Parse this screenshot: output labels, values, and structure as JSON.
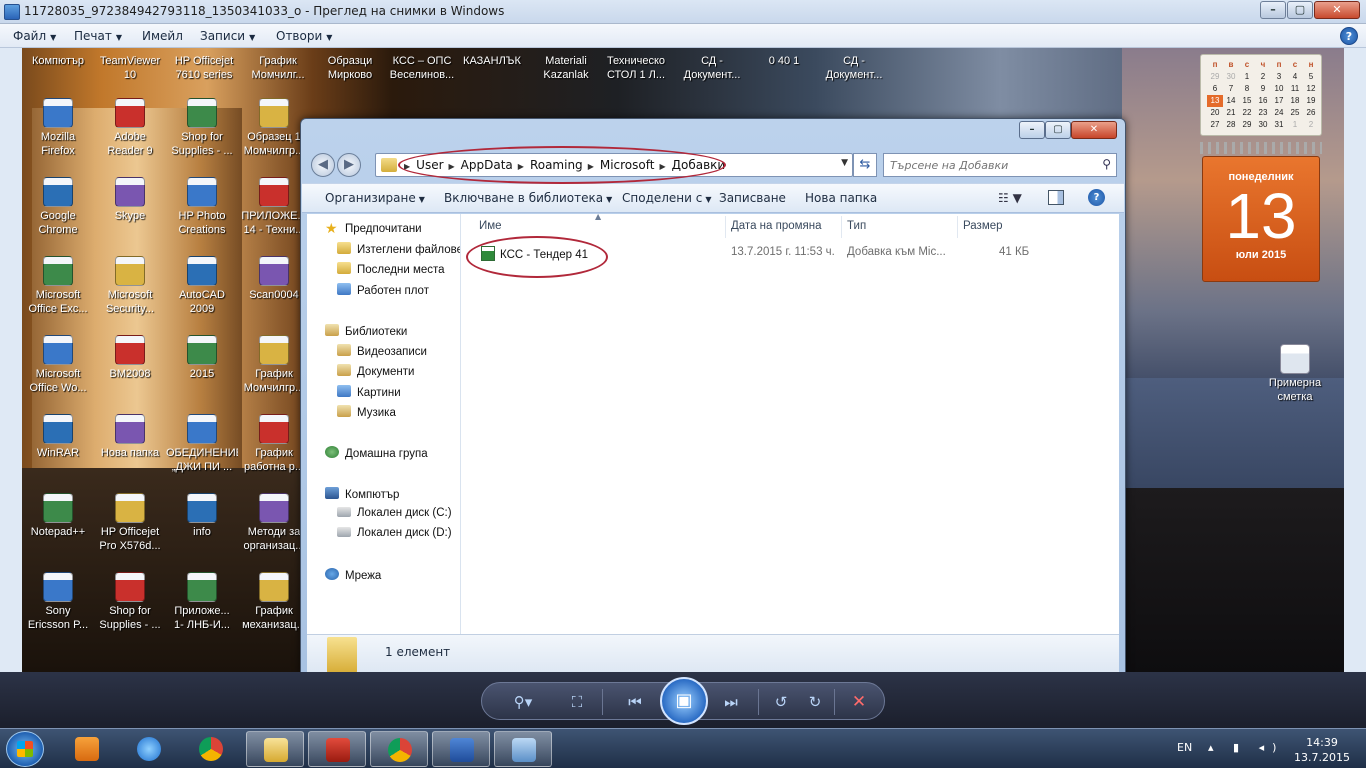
{
  "viewer": {
    "title": "11728035_972384942793118_1350341033_o - Преглед на снимки в Windows",
    "menu": [
      "Файл",
      "Печат",
      "Имейл",
      "Записи",
      "Отвори"
    ],
    "help": "?"
  },
  "desktop": {
    "top_row": [
      "Компютър",
      "TeamViewer\n10",
      "HP Officejet\n7610 series",
      "График\nМомчилг...",
      "Образци\nМирково",
      "КСС – ОПС\nВеселинов...",
      "КАЗАНЛЪК",
      "Materiali\nKazanlak",
      "Техническо\nСТОЛ 1 Л...",
      "СД -\nДокумент...",
      "0 40 1",
      "СД -\nДокумент..."
    ],
    "icons": [
      "Mozilla\nFirefox",
      "Adobe\nReader 9",
      "Shop for\nSupplies - ...",
      "Образец 1\nМомчилгр...",
      "Google\nChrome",
      "Skype",
      "HP Photo\nCreations",
      "ПРИЛОЖЕ...\n14 - Техни...",
      "Microsoft\nOffice Exc...",
      "Microsoft\nSecurity...",
      "AutoCAD\n2009",
      "Scan0004",
      "Microsoft\nOffice Wo...",
      "BM2008",
      "2015",
      "График\nМомчилгр...",
      "WinRAR",
      "Нова папка",
      "ОБЕДИНЕНИЕ\n„ДЖИ ПИ ...",
      "График\nработна р...",
      "Notepad++",
      "HP Officejet\nPro X576d...",
      "info",
      "Методи за\nорганизац...",
      "Sony\nEricsson P...",
      "Shop for\nSupplies - ...",
      "Приложе...\n1- ЛНБ-И...",
      "График\nмеханизац..."
    ],
    "right_icon": "Примерна\nсметка",
    "calendar": {
      "header": [
        "п",
        "в",
        "с",
        "ч",
        "п",
        "с",
        "н"
      ],
      "days": [
        "29",
        "30",
        "1",
        "2",
        "3",
        "4",
        "5",
        "6",
        "7",
        "8",
        "9",
        "10",
        "11",
        "12",
        "13",
        "14",
        "15",
        "16",
        "17",
        "18",
        "19",
        "20",
        "21",
        "22",
        "23",
        "24",
        "25",
        "26",
        "27",
        "28",
        "29",
        "30",
        "31",
        "1",
        "2"
      ],
      "today": "13",
      "weekday": "понеделник",
      "month": "юли 2015"
    }
  },
  "explorer": {
    "breadcrumb": [
      "User",
      "AppData",
      "Roaming",
      "Microsoft",
      "Добавки"
    ],
    "search_placeholder": "Търсене на Добавки",
    "commands": {
      "organize": "Организиране",
      "include_library": "Включване в библиотека",
      "share": "Споделени с",
      "burn": "Записване",
      "new_folder": "Нова папка"
    },
    "nav": {
      "favorites": "Предпочитани",
      "downloads": "Изтеглени файлове",
      "recent": "Последни места",
      "desktop": "Работен плот",
      "libraries": "Библиотеки",
      "videos": "Видеозаписи",
      "documents": "Документи",
      "pictures": "Картини",
      "music": "Музика",
      "homegroup": "Домашна група",
      "computer": "Компютър",
      "drive_c": "Локален диск (C:)",
      "drive_d": "Локален диск (D:)",
      "network": "Мрежа"
    },
    "columns": [
      "Име",
      "Дата на промяна",
      "Тип",
      "Размер"
    ],
    "files": [
      {
        "name": "КСС - Тендер 41",
        "date": "13.7.2015 г. 11:53 ч.",
        "type": "Добавка към Mic...",
        "size": "41 КБ"
      }
    ],
    "status": "1 елемент"
  },
  "taskbar": {
    "lang": "EN",
    "time": "14:39",
    "date": "13.7.2015 г."
  }
}
